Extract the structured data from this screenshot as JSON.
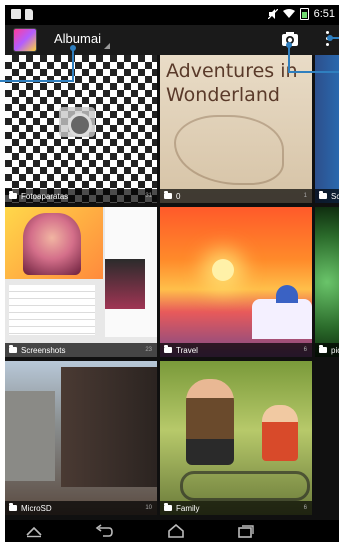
{
  "status_bar": {
    "time": "6:51"
  },
  "action_bar": {
    "title": "Albumai"
  },
  "albums": [
    {
      "name": "Fotoaparatas",
      "count": "31"
    },
    {
      "name": "0",
      "count": "1"
    },
    {
      "name": "Sc",
      "count": ""
    },
    {
      "name": "Screenshots",
      "count": "23"
    },
    {
      "name": "Travel",
      "count": "6"
    },
    {
      "name": "pic",
      "count": ""
    },
    {
      "name": "MicroSD",
      "count": "10"
    },
    {
      "name": "Family",
      "count": "6"
    }
  ],
  "thumb_text": {
    "wonderland": "Adventures in Wonderland"
  },
  "colors": {
    "callout": "#2f7fbf",
    "action_bar": "#1a1a1a",
    "status_bar": "#000000"
  },
  "icons": [
    "picture-icon",
    "document-icon",
    "mute-icon",
    "wifi-icon",
    "battery-icon",
    "camera-icon",
    "overflow-menu-icon",
    "folder-icon",
    "collapse-icon",
    "back-icon",
    "home-icon",
    "recent-apps-icon"
  ]
}
